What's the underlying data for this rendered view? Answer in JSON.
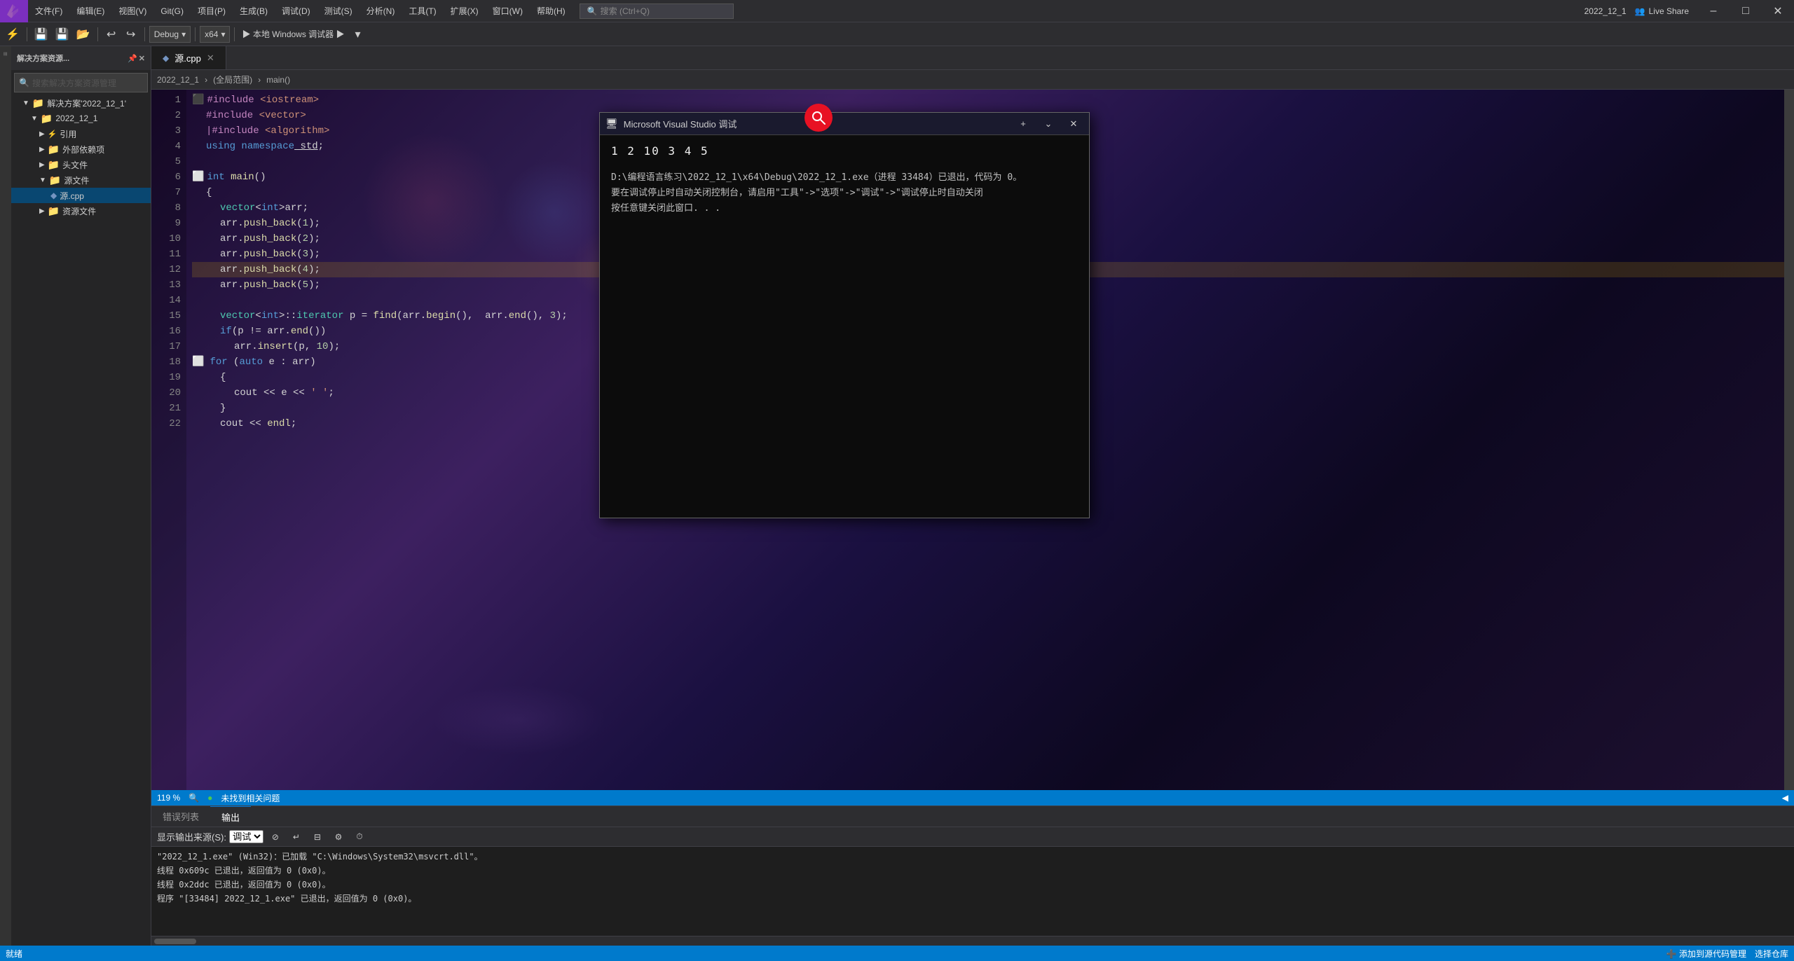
{
  "titlebar": {
    "logo": "VS",
    "menus": [
      "文件(F)",
      "编辑(E)",
      "视图(V)",
      "Git(G)",
      "项目(P)",
      "生成(B)",
      "调试(D)",
      "测试(S)",
      "分析(N)",
      "工具(T)",
      "扩展(X)",
      "窗口(W)",
      "帮助(H)"
    ],
    "search_placeholder": "搜索 (Ctrl+Q)",
    "title": "2022_12_1",
    "live_share": "Live Share",
    "min_btn": "–",
    "max_btn": "□",
    "close_btn": "✕"
  },
  "toolbar": {
    "debug_config": "Debug",
    "platform": "x64",
    "run_label": "▶ 本地 Windows 调试器 ▶"
  },
  "sidebar": {
    "header": "解决方案资源...",
    "search_placeholder": "搜索解决方案资源管理",
    "items": [
      {
        "label": "解决方案'2022_12_1'",
        "indent": 1,
        "arrow": "▼",
        "icon": "📁"
      },
      {
        "label": "2022_12_1",
        "indent": 2,
        "arrow": "▼",
        "icon": "📁"
      },
      {
        "label": "引用",
        "indent": 3,
        "arrow": "▶",
        "icon": "📁"
      },
      {
        "label": "外部依赖项",
        "indent": 3,
        "arrow": "▶",
        "icon": "📁"
      },
      {
        "label": "头文件",
        "indent": 3,
        "arrow": "▶",
        "icon": "📁"
      },
      {
        "label": "源文件",
        "indent": 3,
        "arrow": "▼",
        "icon": "📁"
      },
      {
        "label": "源.cpp",
        "indent": 4,
        "arrow": "",
        "icon": "📄"
      },
      {
        "label": "资源文件",
        "indent": 3,
        "arrow": "▶",
        "icon": "📁"
      }
    ]
  },
  "editor": {
    "tab": "源.cpp",
    "breadcrumb_path": "2022_12_1",
    "breadcrumb_scope": "(全局范围)",
    "breadcrumb_fn": "main()",
    "code_lines": [
      {
        "num": 1,
        "text": "#include <iostream>",
        "type": "include"
      },
      {
        "num": 2,
        "text": "    #include <vector>",
        "type": "include"
      },
      {
        "num": 3,
        "text": "    #include <algorithm>",
        "type": "include"
      },
      {
        "num": 4,
        "text": "    using namespace std;",
        "type": "using"
      },
      {
        "num": 5,
        "text": "",
        "type": "empty"
      },
      {
        "num": 6,
        "text": "int main()",
        "type": "fn"
      },
      {
        "num": 7,
        "text": "    {",
        "type": "brace"
      },
      {
        "num": 8,
        "text": "        vector<int>arr;",
        "type": "code"
      },
      {
        "num": 9,
        "text": "        arr.push_back(1);",
        "type": "code"
      },
      {
        "num": 10,
        "text": "        arr.push_back(2);",
        "type": "code"
      },
      {
        "num": 11,
        "text": "        arr.push_back(3);",
        "type": "code"
      },
      {
        "num": 12,
        "text": "        arr.push_back(4);",
        "type": "code",
        "highlighted": true
      },
      {
        "num": 13,
        "text": "        arr.push_back(5);",
        "type": "code"
      },
      {
        "num": 14,
        "text": "",
        "type": "empty"
      },
      {
        "num": 15,
        "text": "        vector<int>::iterator p = find(arr.begin(),  arr.end(), 3);",
        "type": "code"
      },
      {
        "num": 16,
        "text": "        if(p != arr.end())",
        "type": "code"
      },
      {
        "num": 17,
        "text": "            arr.insert(p, 10);",
        "type": "code"
      },
      {
        "num": 18,
        "text": "    for (auto e : arr)",
        "type": "code"
      },
      {
        "num": 19,
        "text": "        {",
        "type": "brace"
      },
      {
        "num": 20,
        "text": "            cout << e << ' ';",
        "type": "code"
      },
      {
        "num": 21,
        "text": "        }",
        "type": "brace"
      },
      {
        "num": 22,
        "text": "        cout << endl;",
        "type": "code"
      }
    ],
    "zoom": "119 %",
    "status": "未找到相关问题"
  },
  "output": {
    "tabs": [
      "错误列表",
      "输出"
    ],
    "active_tab": "输出",
    "source_label": "显示输出来源(S):",
    "source_value": "调试",
    "lines": [
      "\"2022_12_1.exe\" (Win32)：已加载 \"C:\\Windows\\System32\\msvcrt.dll\"。",
      "线程 0x609c 已退出，返回值为 0 (0x0)。",
      "线程 0x2ddc 已退出，返回值为 0 (0x0)。",
      "程序 \"[33484] 2022_12_1.exe\" 已退出，返回值为 0 (0x0)。"
    ]
  },
  "console": {
    "title": "Microsoft Visual Studio 调试",
    "output": "1 2 10 3 4 5",
    "info_line1": "D:\\编程语言练习\\2022_12_1\\x64\\Debug\\2022_12_1.exe（进程 33484）已退出，代码为 0。",
    "info_line2": "要在调试停止时自动关闭控制台，请启用\"工具\"->\"选项\"->\"调试\"->\"调试停止时自动关闭",
    "info_line3": "按任意键关闭此窗口. . ."
  },
  "status_bar": {
    "left": "就绪",
    "add_to_source": "➕ 添加到源代码管理",
    "select_repo": "选择仓库"
  },
  "icons": {
    "search": "🔍",
    "close": "✕",
    "expand": "🔽",
    "live_share": "👥",
    "play": "▶",
    "add_source": "➕"
  }
}
